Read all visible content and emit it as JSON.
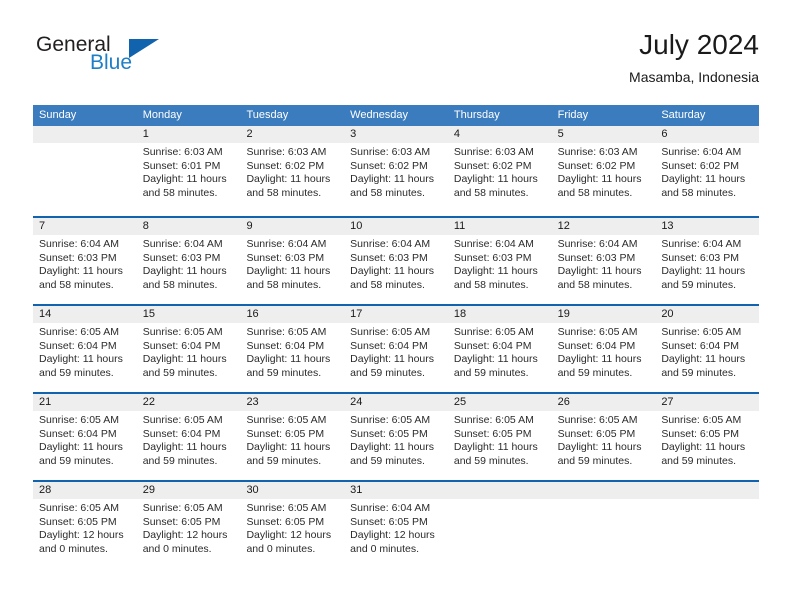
{
  "brand": {
    "name_part1": "General",
    "name_part2": "Blue",
    "triangle_color": "#1263ad",
    "blue_color": "#1e7fc6"
  },
  "header": {
    "title": "July 2024",
    "subtitle": "Masamba, Indonesia"
  },
  "colors": {
    "header_bar": "#3b7cbe",
    "week_divider": "#1263ad",
    "day_number_band": "#eeeeee"
  },
  "calendar": {
    "weekday_headers": [
      "Sunday",
      "Monday",
      "Tuesday",
      "Wednesday",
      "Thursday",
      "Friday",
      "Saturday"
    ],
    "weeks": [
      [
        {
          "day": "",
          "sunrise": "",
          "sunset": "",
          "daylight_line1": "",
          "daylight_line2": ""
        },
        {
          "day": "1",
          "sunrise": "Sunrise: 6:03 AM",
          "sunset": "Sunset: 6:01 PM",
          "daylight_line1": "Daylight: 11 hours",
          "daylight_line2": "and 58 minutes."
        },
        {
          "day": "2",
          "sunrise": "Sunrise: 6:03 AM",
          "sunset": "Sunset: 6:02 PM",
          "daylight_line1": "Daylight: 11 hours",
          "daylight_line2": "and 58 minutes."
        },
        {
          "day": "3",
          "sunrise": "Sunrise: 6:03 AM",
          "sunset": "Sunset: 6:02 PM",
          "daylight_line1": "Daylight: 11 hours",
          "daylight_line2": "and 58 minutes."
        },
        {
          "day": "4",
          "sunrise": "Sunrise: 6:03 AM",
          "sunset": "Sunset: 6:02 PM",
          "daylight_line1": "Daylight: 11 hours",
          "daylight_line2": "and 58 minutes."
        },
        {
          "day": "5",
          "sunrise": "Sunrise: 6:03 AM",
          "sunset": "Sunset: 6:02 PM",
          "daylight_line1": "Daylight: 11 hours",
          "daylight_line2": "and 58 minutes."
        },
        {
          "day": "6",
          "sunrise": "Sunrise: 6:04 AM",
          "sunset": "Sunset: 6:02 PM",
          "daylight_line1": "Daylight: 11 hours",
          "daylight_line2": "and 58 minutes."
        }
      ],
      [
        {
          "day": "7",
          "sunrise": "Sunrise: 6:04 AM",
          "sunset": "Sunset: 6:03 PM",
          "daylight_line1": "Daylight: 11 hours",
          "daylight_line2": "and 58 minutes."
        },
        {
          "day": "8",
          "sunrise": "Sunrise: 6:04 AM",
          "sunset": "Sunset: 6:03 PM",
          "daylight_line1": "Daylight: 11 hours",
          "daylight_line2": "and 58 minutes."
        },
        {
          "day": "9",
          "sunrise": "Sunrise: 6:04 AM",
          "sunset": "Sunset: 6:03 PM",
          "daylight_line1": "Daylight: 11 hours",
          "daylight_line2": "and 58 minutes."
        },
        {
          "day": "10",
          "sunrise": "Sunrise: 6:04 AM",
          "sunset": "Sunset: 6:03 PM",
          "daylight_line1": "Daylight: 11 hours",
          "daylight_line2": "and 58 minutes."
        },
        {
          "day": "11",
          "sunrise": "Sunrise: 6:04 AM",
          "sunset": "Sunset: 6:03 PM",
          "daylight_line1": "Daylight: 11 hours",
          "daylight_line2": "and 58 minutes."
        },
        {
          "day": "12",
          "sunrise": "Sunrise: 6:04 AM",
          "sunset": "Sunset: 6:03 PM",
          "daylight_line1": "Daylight: 11 hours",
          "daylight_line2": "and 58 minutes."
        },
        {
          "day": "13",
          "sunrise": "Sunrise: 6:04 AM",
          "sunset": "Sunset: 6:03 PM",
          "daylight_line1": "Daylight: 11 hours",
          "daylight_line2": "and 59 minutes."
        }
      ],
      [
        {
          "day": "14",
          "sunrise": "Sunrise: 6:05 AM",
          "sunset": "Sunset: 6:04 PM",
          "daylight_line1": "Daylight: 11 hours",
          "daylight_line2": "and 59 minutes."
        },
        {
          "day": "15",
          "sunrise": "Sunrise: 6:05 AM",
          "sunset": "Sunset: 6:04 PM",
          "daylight_line1": "Daylight: 11 hours",
          "daylight_line2": "and 59 minutes."
        },
        {
          "day": "16",
          "sunrise": "Sunrise: 6:05 AM",
          "sunset": "Sunset: 6:04 PM",
          "daylight_line1": "Daylight: 11 hours",
          "daylight_line2": "and 59 minutes."
        },
        {
          "day": "17",
          "sunrise": "Sunrise: 6:05 AM",
          "sunset": "Sunset: 6:04 PM",
          "daylight_line1": "Daylight: 11 hours",
          "daylight_line2": "and 59 minutes."
        },
        {
          "day": "18",
          "sunrise": "Sunrise: 6:05 AM",
          "sunset": "Sunset: 6:04 PM",
          "daylight_line1": "Daylight: 11 hours",
          "daylight_line2": "and 59 minutes."
        },
        {
          "day": "19",
          "sunrise": "Sunrise: 6:05 AM",
          "sunset": "Sunset: 6:04 PM",
          "daylight_line1": "Daylight: 11 hours",
          "daylight_line2": "and 59 minutes."
        },
        {
          "day": "20",
          "sunrise": "Sunrise: 6:05 AM",
          "sunset": "Sunset: 6:04 PM",
          "daylight_line1": "Daylight: 11 hours",
          "daylight_line2": "and 59 minutes."
        }
      ],
      [
        {
          "day": "21",
          "sunrise": "Sunrise: 6:05 AM",
          "sunset": "Sunset: 6:04 PM",
          "daylight_line1": "Daylight: 11 hours",
          "daylight_line2": "and 59 minutes."
        },
        {
          "day": "22",
          "sunrise": "Sunrise: 6:05 AM",
          "sunset": "Sunset: 6:04 PM",
          "daylight_line1": "Daylight: 11 hours",
          "daylight_line2": "and 59 minutes."
        },
        {
          "day": "23",
          "sunrise": "Sunrise: 6:05 AM",
          "sunset": "Sunset: 6:05 PM",
          "daylight_line1": "Daylight: 11 hours",
          "daylight_line2": "and 59 minutes."
        },
        {
          "day": "24",
          "sunrise": "Sunrise: 6:05 AM",
          "sunset": "Sunset: 6:05 PM",
          "daylight_line1": "Daylight: 11 hours",
          "daylight_line2": "and 59 minutes."
        },
        {
          "day": "25",
          "sunrise": "Sunrise: 6:05 AM",
          "sunset": "Sunset: 6:05 PM",
          "daylight_line1": "Daylight: 11 hours",
          "daylight_line2": "and 59 minutes."
        },
        {
          "day": "26",
          "sunrise": "Sunrise: 6:05 AM",
          "sunset": "Sunset: 6:05 PM",
          "daylight_line1": "Daylight: 11 hours",
          "daylight_line2": "and 59 minutes."
        },
        {
          "day": "27",
          "sunrise": "Sunrise: 6:05 AM",
          "sunset": "Sunset: 6:05 PM",
          "daylight_line1": "Daylight: 11 hours",
          "daylight_line2": "and 59 minutes."
        }
      ],
      [
        {
          "day": "28",
          "sunrise": "Sunrise: 6:05 AM",
          "sunset": "Sunset: 6:05 PM",
          "daylight_line1": "Daylight: 12 hours",
          "daylight_line2": "and 0 minutes."
        },
        {
          "day": "29",
          "sunrise": "Sunrise: 6:05 AM",
          "sunset": "Sunset: 6:05 PM",
          "daylight_line1": "Daylight: 12 hours",
          "daylight_line2": "and 0 minutes."
        },
        {
          "day": "30",
          "sunrise": "Sunrise: 6:05 AM",
          "sunset": "Sunset: 6:05 PM",
          "daylight_line1": "Daylight: 12 hours",
          "daylight_line2": "and 0 minutes."
        },
        {
          "day": "31",
          "sunrise": "Sunrise: 6:04 AM",
          "sunset": "Sunset: 6:05 PM",
          "daylight_line1": "Daylight: 12 hours",
          "daylight_line2": "and 0 minutes."
        },
        {
          "day": "",
          "sunrise": "",
          "sunset": "",
          "daylight_line1": "",
          "daylight_line2": ""
        },
        {
          "day": "",
          "sunrise": "",
          "sunset": "",
          "daylight_line1": "",
          "daylight_line2": ""
        },
        {
          "day": "",
          "sunrise": "",
          "sunset": "",
          "daylight_line1": "",
          "daylight_line2": ""
        }
      ]
    ]
  }
}
